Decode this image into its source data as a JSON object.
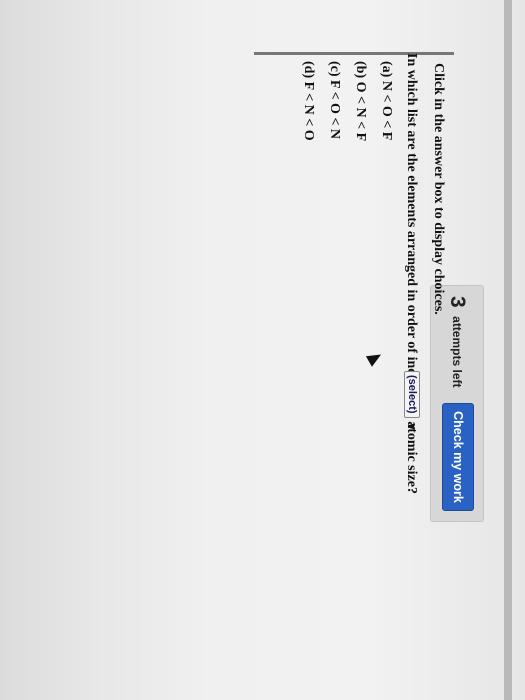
{
  "toolbar": {
    "attempts_count": "3",
    "attempts_label": "attempts left",
    "check_button_label": "Check my work"
  },
  "question": {
    "instruction": "Click in the answer box to display choices.",
    "prompt": "In which list are the elements arranged in order of increasing atomic size?",
    "select_value": "(select)",
    "choices": [
      "(a) N < O < F",
      "(b) O < N < F",
      "(c) F < O < N",
      "(d) F < N < O"
    ]
  }
}
